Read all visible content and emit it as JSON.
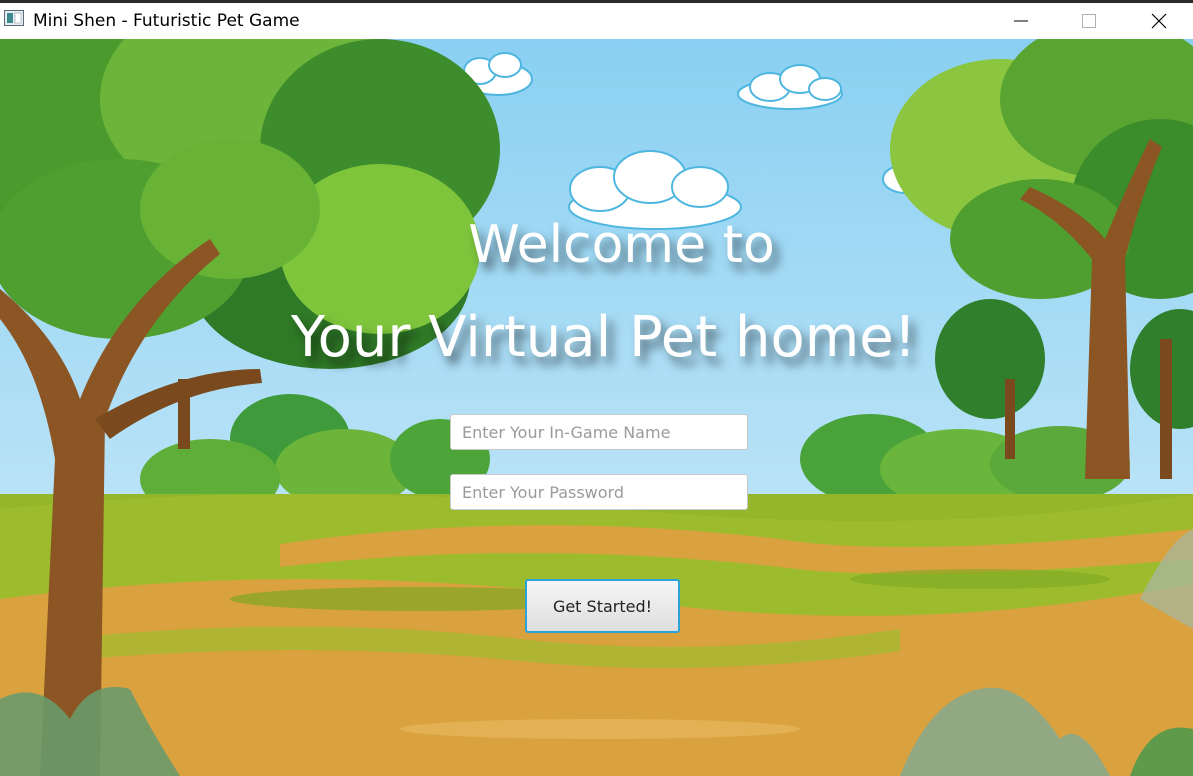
{
  "window": {
    "title": "Mini Shen - Futuristic Pet Game",
    "icon": "java-app-icon",
    "controls": [
      "minimize-icon",
      "maximize-icon",
      "close-icon"
    ]
  },
  "welcome": {
    "line1": "Welcome to",
    "line2": "Your Virtual Pet home!"
  },
  "form": {
    "name_placeholder": "Enter Your In-Game Name",
    "name_value": "",
    "password_placeholder": "Enter Your Password",
    "password_value": "",
    "submit_label": "Get Started!"
  },
  "colors": {
    "sky": "#a9dcf5",
    "grass": "#93b62a",
    "path": "#d9a23e",
    "button_border": "#2aa3d8"
  }
}
